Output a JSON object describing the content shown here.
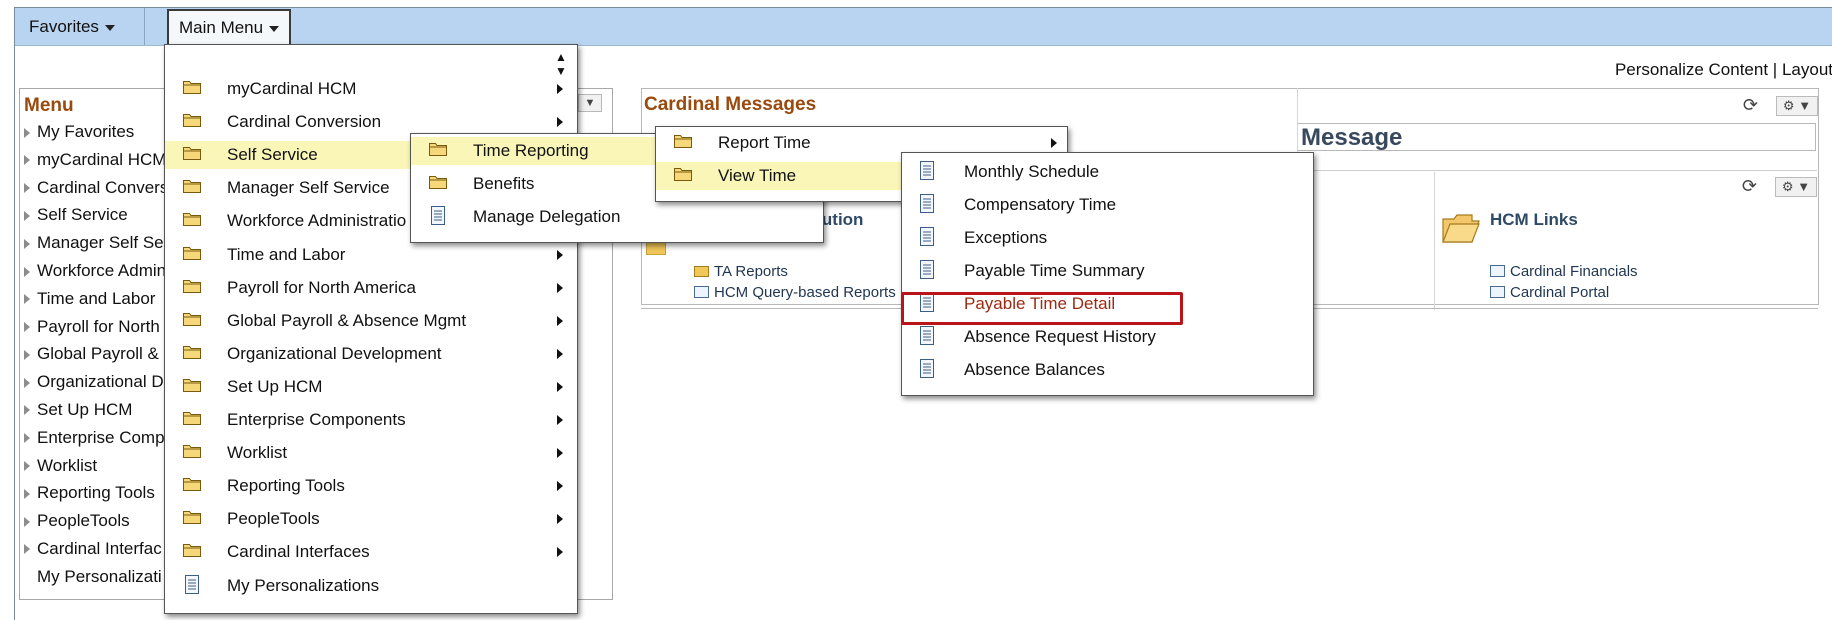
{
  "topbar": {
    "favorites": "Favorites",
    "main_menu": "Main Menu"
  },
  "personalize": {
    "content": "Personalize Content",
    "sep": "|",
    "layout": "Layout"
  },
  "left_pagelet": {
    "title": "Menu",
    "items": [
      {
        "label": "My Favorites",
        "tri": true
      },
      {
        "label": "myCardinal HCM",
        "tri": true
      },
      {
        "label": "Cardinal Convers",
        "tri": true
      },
      {
        "label": "Self Service",
        "tri": true
      },
      {
        "label": "Manager Self Se",
        "tri": true
      },
      {
        "label": "Workforce Admin",
        "tri": true
      },
      {
        "label": "Time and Labor",
        "tri": true
      },
      {
        "label": "Payroll for North",
        "tri": true
      },
      {
        "label": "Global Payroll &",
        "tri": true
      },
      {
        "label": "Organizational D",
        "tri": true
      },
      {
        "label": "Set Up HCM",
        "tri": true
      },
      {
        "label": "Enterprise Comp",
        "tri": true
      },
      {
        "label": "Worklist",
        "tri": true
      },
      {
        "label": "Reporting Tools",
        "tri": true
      },
      {
        "label": "PeopleTools",
        "tri": true
      },
      {
        "label": "Cardinal Interfac",
        "tri": true
      },
      {
        "label": "My Personalizati",
        "tri": false
      }
    ]
  },
  "cardinal_messages": {
    "title": "Cardinal Messages",
    "message_header": "Message"
  },
  "second_pagelet": {
    "label_partial": "ecution",
    "links": {
      "ta_reports": "TA Reports",
      "hcm_query": "HCM Query-based Reports"
    }
  },
  "hcm_links": {
    "title": "HCM Links",
    "links": {
      "financials": "Cardinal Financials",
      "portal": "Cardinal Portal"
    }
  },
  "main_menu": {
    "items": [
      {
        "label": "myCardinal HCM",
        "icon": "folder",
        "arrow": true
      },
      {
        "label": "Cardinal Conversion",
        "icon": "folder",
        "arrow": true
      },
      {
        "label": "Self Service",
        "icon": "folder",
        "arrow": false,
        "highlight": true
      },
      {
        "label": "Manager Self Service",
        "icon": "folder",
        "arrow": false
      },
      {
        "label": "Workforce Administratio",
        "icon": "folder",
        "arrow": false
      },
      {
        "label": "Time and Labor",
        "icon": "folder",
        "arrow": true
      },
      {
        "label": "Payroll for North America",
        "icon": "folder",
        "arrow": true
      },
      {
        "label": "Global Payroll & Absence Mgmt",
        "icon": "folder",
        "arrow": true
      },
      {
        "label": "Organizational Development",
        "icon": "folder",
        "arrow": true
      },
      {
        "label": "Set Up HCM",
        "icon": "folder",
        "arrow": true
      },
      {
        "label": "Enterprise Components",
        "icon": "folder",
        "arrow": true
      },
      {
        "label": "Worklist",
        "icon": "folder",
        "arrow": true
      },
      {
        "label": "Reporting Tools",
        "icon": "folder",
        "arrow": true
      },
      {
        "label": "PeopleTools",
        "icon": "folder",
        "arrow": true
      },
      {
        "label": "Cardinal Interfaces",
        "icon": "folder",
        "arrow": true
      },
      {
        "label": "My Personalizations",
        "icon": "document",
        "arrow": false
      }
    ]
  },
  "self_service_menu": {
    "items": [
      {
        "label": "Time Reporting",
        "icon": "folder",
        "highlight": true
      },
      {
        "label": "Benefits",
        "icon": "folder"
      },
      {
        "label": "Manage Delegation",
        "icon": "document"
      }
    ]
  },
  "time_reporting_menu": {
    "items": [
      {
        "label": "Report Time",
        "icon": "folder",
        "arrow": true
      },
      {
        "label": "View Time",
        "icon": "folder",
        "highlight": true
      }
    ]
  },
  "view_time_menu": {
    "items": [
      {
        "label": "Monthly Schedule",
        "icon": "document"
      },
      {
        "label": "Compensatory Time",
        "icon": "document"
      },
      {
        "label": "Exceptions",
        "icon": "document"
      },
      {
        "label": "Payable Time Summary",
        "icon": "document"
      },
      {
        "label": "Payable Time Detail",
        "icon": "document",
        "selected": true
      },
      {
        "label": "Absence Request History",
        "icon": "document"
      },
      {
        "label": "Absence Balances",
        "icon": "document"
      }
    ]
  },
  "colors": {
    "topbar": "#b8d4f0",
    "pagelet_title": "#9a4a0e",
    "highlight": "#f9f6b8",
    "selection_box": "#b8141a",
    "selected_text": "#9a2a10"
  }
}
